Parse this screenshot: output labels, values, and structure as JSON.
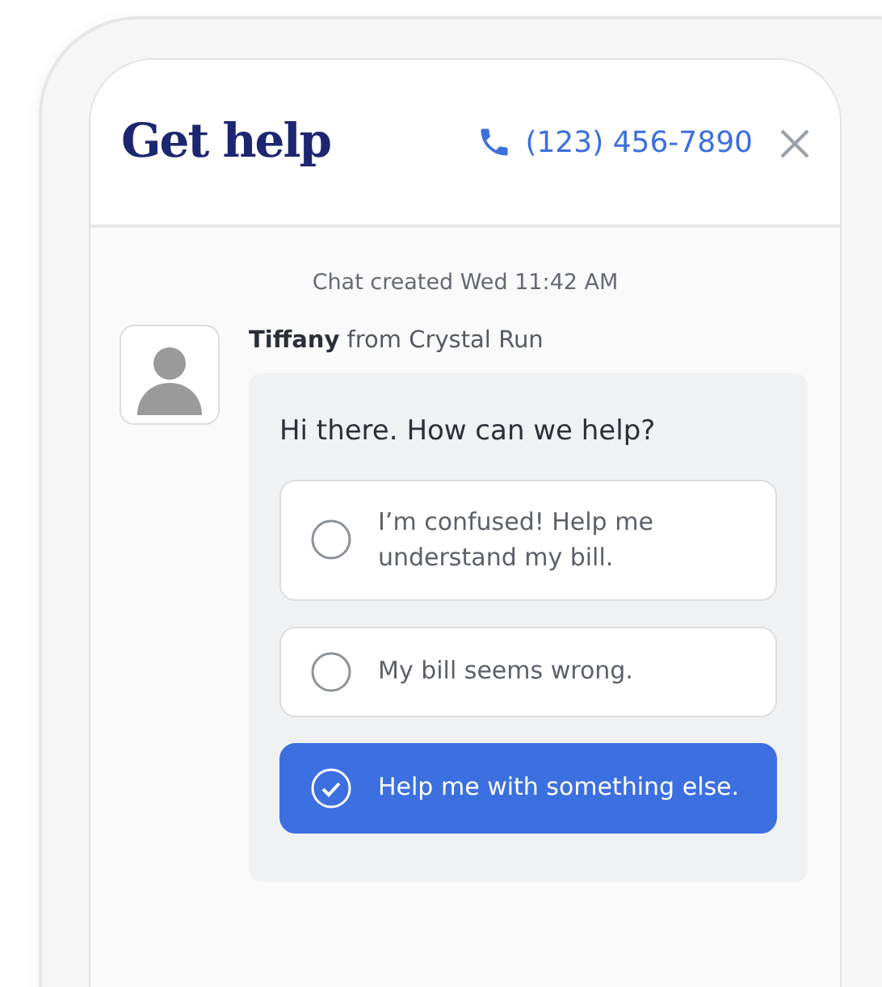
{
  "header": {
    "title": "Get help",
    "phone": "(123) 456-7890"
  },
  "chat_created": "Chat created Wed 11:42 AM",
  "agent": {
    "name": "Tiffany",
    "from": "from Crystal Run"
  },
  "message": "Hi there. How can we help?",
  "options": [
    {
      "label": "I’m confused! Help me understand my bill.",
      "selected": false
    },
    {
      "label": "My bill seems wrong.",
      "selected": false
    },
    {
      "label": "Help me with something else.",
      "selected": true
    }
  ]
}
